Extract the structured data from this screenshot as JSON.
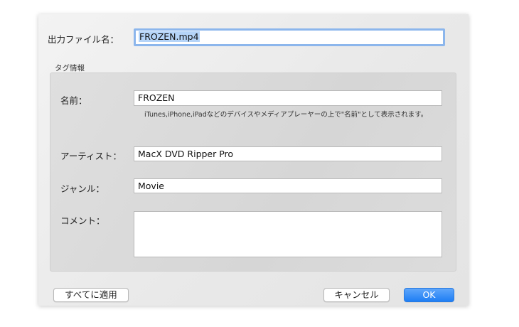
{
  "output": {
    "label": "出力ファイル名：",
    "value": "FROZEN.mp4"
  },
  "tag_group": {
    "title": "タグ情報"
  },
  "fields": {
    "name": {
      "label": "名前：",
      "value": "FROZEN"
    },
    "hint": "iTunes,iPhone,iPadなどのデバイスやメディアプレーヤーの上で\"名前\"として表示されます。",
    "artist": {
      "label": "アーティスト：",
      "value": "MacX DVD Ripper Pro"
    },
    "genre": {
      "label": "ジャンル：",
      "value": "Movie"
    },
    "comment": {
      "label": "コメント：",
      "value": ""
    }
  },
  "buttons": {
    "apply_all": "すべてに適用",
    "cancel": "キャンセル",
    "ok": "OK"
  }
}
